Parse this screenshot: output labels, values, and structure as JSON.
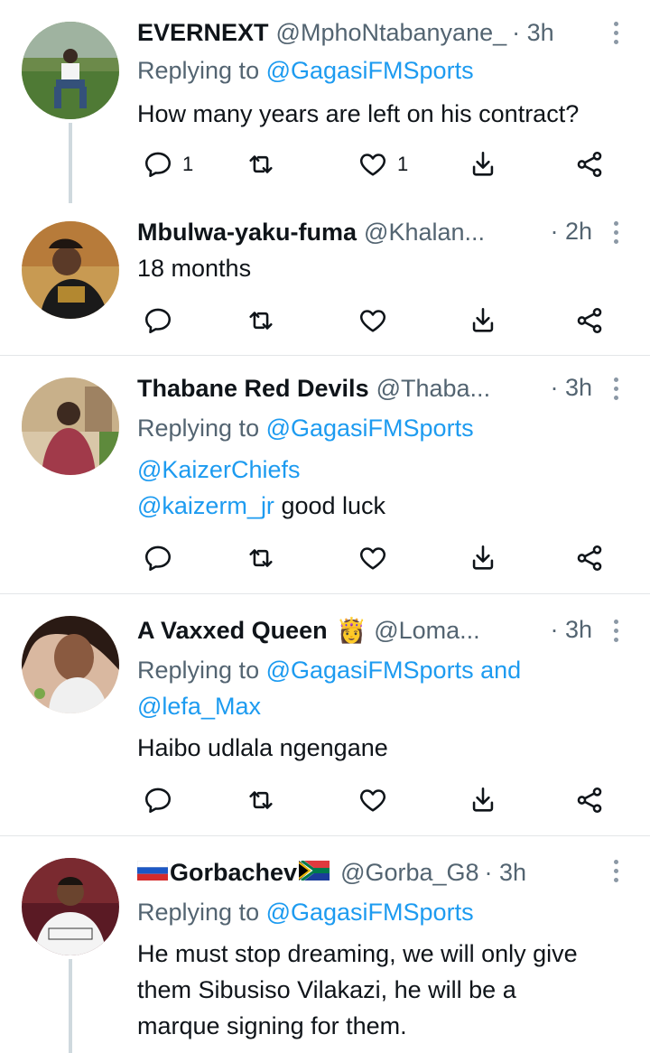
{
  "tweets": [
    {
      "name": "EVERNEXT",
      "handle": "@MphoNtabanyane_",
      "time": "· 3h",
      "replying_prefix": "Replying to ",
      "replying_to": "@GagasiFMSports",
      "text": "How many years are left on his contract?",
      "reply_count": "1",
      "like_count": "1"
    },
    {
      "name": "Mbulwa-yaku-fuma",
      "handle": "@Khalan...",
      "time": "· 2h",
      "text": "18 months"
    },
    {
      "name": "Thabane Red Devils",
      "handle": "@Thaba...",
      "time": "· 3h",
      "replying_prefix": "Replying to ",
      "replying_to": "@GagasiFMSports",
      "mention_line": "@KaizerChiefs",
      "mention_inline": "@kaizerm_jr",
      "text": " good luck"
    },
    {
      "name": "A Vaxxed Queen",
      "emoji": "👸",
      "handle": "@Loma...",
      "time": "· 3h",
      "replying_prefix": "Replying to ",
      "replying_to": "@GagasiFMSports",
      "replying_and": " and",
      "replying_to_2": "@lefa_Max",
      "text": "Haibo udlala ngengane"
    },
    {
      "name": "Gorbachev",
      "handle": "@Gorba_G8",
      "time": "· 3h",
      "replying_prefix": "Replying to ",
      "replying_to": "@GagasiFMSports",
      "text_lines": [
        "He must stop dreaming, we will only give",
        "them Sibusiso Vilakazi, he will be a",
        "marque signing for them."
      ]
    }
  ],
  "colors": {
    "link": "#1d9bf0",
    "muted": "#536471",
    "divider": "#e3e6e8"
  },
  "icons": [
    "reply-icon",
    "retweet-icon",
    "like-icon",
    "download-icon",
    "share-icon",
    "more-icon"
  ]
}
